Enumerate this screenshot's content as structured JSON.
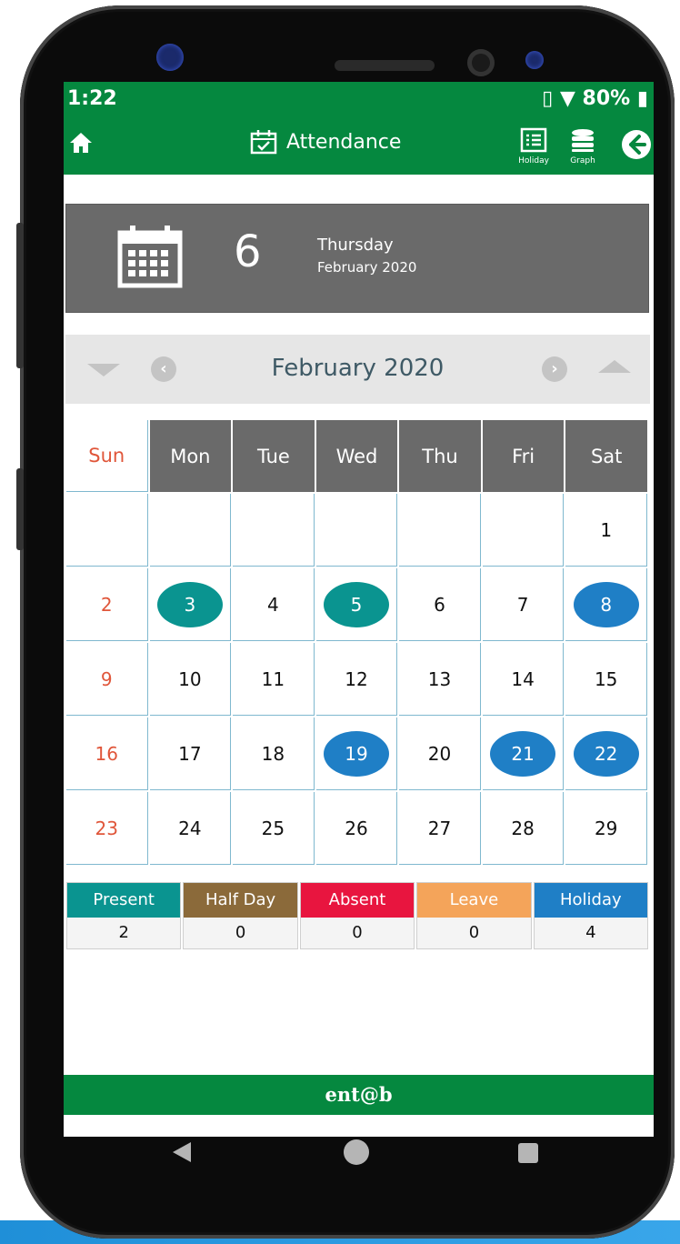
{
  "status_bar": {
    "time": "1:22",
    "battery": "80%"
  },
  "header": {
    "title": "Attendance",
    "holiday_label": "Holiday",
    "graph_label": "Graph"
  },
  "banner": {
    "day": "6",
    "weekday": "Thursday",
    "month_year": "February 2020"
  },
  "calendar": {
    "month_label": "February 2020",
    "weekdays": [
      "Sun",
      "Mon",
      "Tue",
      "Wed",
      "Thu",
      "Fri",
      "Sat"
    ],
    "weeks": [
      [
        "",
        "",
        "",
        "",
        "",
        "",
        "1"
      ],
      [
        "2",
        "3",
        "4",
        "5",
        "6",
        "7",
        "8"
      ],
      [
        "9",
        "10",
        "11",
        "12",
        "13",
        "14",
        "15"
      ],
      [
        "16",
        "17",
        "18",
        "19",
        "20",
        "21",
        "22"
      ],
      [
        "23",
        "24",
        "25",
        "26",
        "27",
        "28",
        "29"
      ]
    ],
    "present_days": [
      "3",
      "5"
    ],
    "holiday_days": [
      "8",
      "19",
      "21",
      "22"
    ]
  },
  "summary": [
    {
      "label": "Present",
      "value": "2",
      "color": "#0a9490"
    },
    {
      "label": "Half Day",
      "value": "0",
      "color": "#8b6a3a"
    },
    {
      "label": "Absent",
      "value": "0",
      "color": "#e8153f"
    },
    {
      "label": "Leave",
      "value": "0",
      "color": "#f4a45a"
    },
    {
      "label": "Holiday",
      "value": "4",
      "color": "#1f7fc6"
    }
  ],
  "footer": {
    "brand": "ent@b"
  },
  "colors": {
    "app_green": "#05883f",
    "present": "#0a9490",
    "holiday": "#1f7fc6",
    "sunday_text": "#e0563a"
  }
}
